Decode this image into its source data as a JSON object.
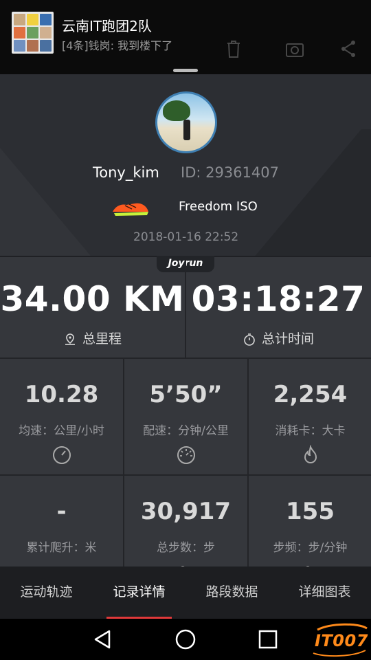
{
  "notification": {
    "title": "云南IT跑团2队",
    "message": "[4条]钱岗: 我到楼下了",
    "group_avatar_colors": [
      "#c8a880",
      "#f0d040",
      "#3a6fb0",
      "#e07040",
      "#6aa060",
      "#d0b090",
      "#7090c0",
      "#b07050",
      "#4a70a0"
    ],
    "toolbar_icons": [
      "trash-icon",
      "camera-icon",
      "share-icon"
    ]
  },
  "profile": {
    "username": "Tony_kim",
    "user_id": "ID: 29361407",
    "shoe_name": "Freedom ISO",
    "date": "2018-01-16 22:52",
    "shoe_colors": [
      "#ff5a1f",
      "#c8f23a"
    ]
  },
  "stats": {
    "brand_badge": "Joyrun",
    "distance": {
      "value": "34.00 KM",
      "label": "总里程"
    },
    "duration": {
      "value": "03:18:27",
      "label": "总计时间"
    },
    "cells": [
      {
        "value": "10.28",
        "label": "均速：公里/小时",
        "icon": "speedometer-icon"
      },
      {
        "value": "5’50”",
        "label": "配速：分钟/公里",
        "icon": "pace-gauge-icon"
      },
      {
        "value": "2,254",
        "label": "消耗卡：大卡",
        "icon": "flame-icon"
      },
      {
        "value": "-",
        "label": "累计爬升：米",
        "icon": "climb-icon"
      },
      {
        "value": "30,917",
        "label": "总步数：步",
        "icon": "footsteps-icon"
      },
      {
        "value": "155",
        "label": "步频：步/分钟",
        "icon": "cadence-icon"
      }
    ]
  },
  "tabs": [
    {
      "label": "运动轨迹",
      "active": false
    },
    {
      "label": "记录详情",
      "active": true
    },
    {
      "label": "路段数据",
      "active": false
    },
    {
      "label": "详细图表",
      "active": false
    }
  ],
  "navbar": {
    "buttons": [
      "back-icon",
      "home-icon",
      "recents-icon"
    ],
    "watermark": "IT007"
  },
  "colors": {
    "accent_red": "#e0393a",
    "panel": "#35373c",
    "header": "#2c2e33",
    "watermark_orange": "#ff8a1a"
  }
}
